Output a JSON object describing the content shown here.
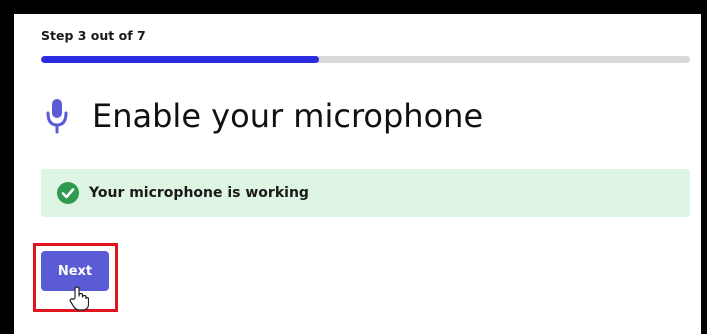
{
  "wizard": {
    "step_label": "Step 3 out of 7",
    "progress_fraction": 0.4286,
    "title": "Enable your microphone",
    "status_message": "Your microphone is working",
    "next_label": "Next"
  },
  "icons": {
    "title_icon": "microphone-icon",
    "status_icon": "check-circle-icon",
    "cursor": "hand-pointer-icon"
  },
  "colors": {
    "accent": "#5b5bd6",
    "progress_fill": "#2b2be0",
    "progress_track": "#d8d8d8",
    "success_bg": "#dff5e3",
    "success_icon": "#2e9b4e",
    "highlight": "#e0151d",
    "button_bg": "#5b5bd6"
  }
}
